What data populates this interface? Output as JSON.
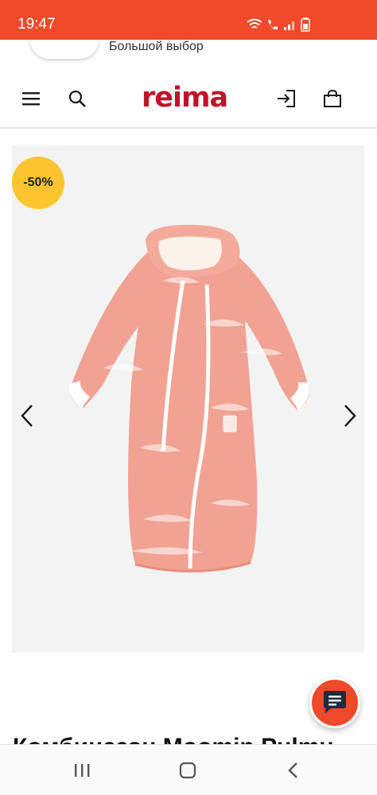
{
  "status_bar": {
    "time": "19:47",
    "icons": [
      "wifi-icon",
      "call-icon",
      "signal-icon",
      "battery-icon"
    ],
    "background": "#f04a2a"
  },
  "promo": {
    "text": "Большой выбор"
  },
  "header": {
    "logo": "reima",
    "logo_color": "#c1122a",
    "icons": [
      "menu-icon",
      "search-icon",
      "login-icon",
      "cart-icon"
    ]
  },
  "product": {
    "discount_badge": "-50%",
    "badge_color": "#fcc52f",
    "image_subject": "peach baby winter sleeping bag overall",
    "title": "Комбинезон Moomin Pulmu"
  },
  "chat_button": {
    "icon": "chat-icon",
    "color": "#f04a2a"
  },
  "system_nav": {
    "icons": [
      "recent-apps-icon",
      "home-icon",
      "back-icon"
    ]
  }
}
